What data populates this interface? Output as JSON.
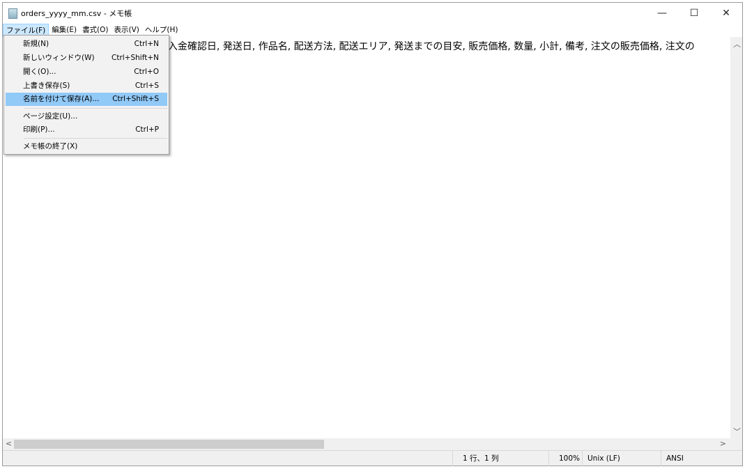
{
  "window": {
    "title": "orders_yyyy_mm.csv - メモ帳",
    "minimize": "—",
    "maximize": "☐",
    "close": "✕"
  },
  "menubar": [
    "ファイル(F)",
    "編集(E)",
    "書式(O)",
    "表示(V)",
    "ヘルプ(H)"
  ],
  "file_menu": [
    {
      "label": "新規(N)",
      "shortcut": "Ctrl+N"
    },
    {
      "label": "新しいウィンドウ(W)",
      "shortcut": "Ctrl+Shift+N"
    },
    {
      "label": "開く(O)...",
      "shortcut": "Ctrl+O"
    },
    {
      "label": "上書き保存(S)",
      "shortcut": "Ctrl+S"
    },
    {
      "label": "名前を付けて保存(A)...",
      "shortcut": "Ctrl+Shift+S"
    },
    {
      "label": "ページ設定(U)...",
      "shortcut": ""
    },
    {
      "label": "印刷(P)...",
      "shortcut": "Ctrl+P"
    },
    {
      "label": "メモ帳の終了(X)",
      "shortcut": ""
    }
  ],
  "editor": {
    "line1": ", 入金確認日, 発送日, 作品名, 配送方法, 配送エリア, 発送までの目安, 販売価格, 数量, 小計, 備考, 注文の販売価格, 注文の"
  },
  "status": {
    "position": "1 行、1 列",
    "zoom": "100%",
    "line_ending": "Unix (LF)",
    "encoding": "ANSI"
  }
}
